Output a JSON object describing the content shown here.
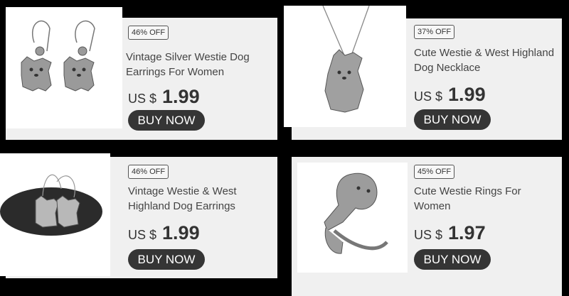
{
  "products": [
    {
      "discount": "46% OFF",
      "title_line1": "Vintage Silver Westie Dog",
      "title_line2": "Earrings For Women",
      "currency": "US $",
      "price": "1.99",
      "button": "BUY NOW",
      "image": "westie-earrings-pair"
    },
    {
      "discount": "37% OFF",
      "title_line1": "Cute Westie & West Highland",
      "title_line2": "Dog Necklace",
      "currency": "US $",
      "price": "1.99",
      "button": "BUY NOW",
      "image": "westie-necklace"
    },
    {
      "discount": "46% OFF",
      "title_line1": "Vintage Westie & West",
      "title_line2": "Highland Dog Earrings",
      "currency": "US $",
      "price": "1.99",
      "button": "BUY NOW",
      "image": "westie-earrings-on-stone"
    },
    {
      "discount": "45% OFF",
      "title_line1": "Cute Westie Rings For",
      "title_line2": "Women",
      "currency": "US $",
      "price": "1.97",
      "button": "BUY NOW",
      "image": "westie-ring"
    }
  ]
}
